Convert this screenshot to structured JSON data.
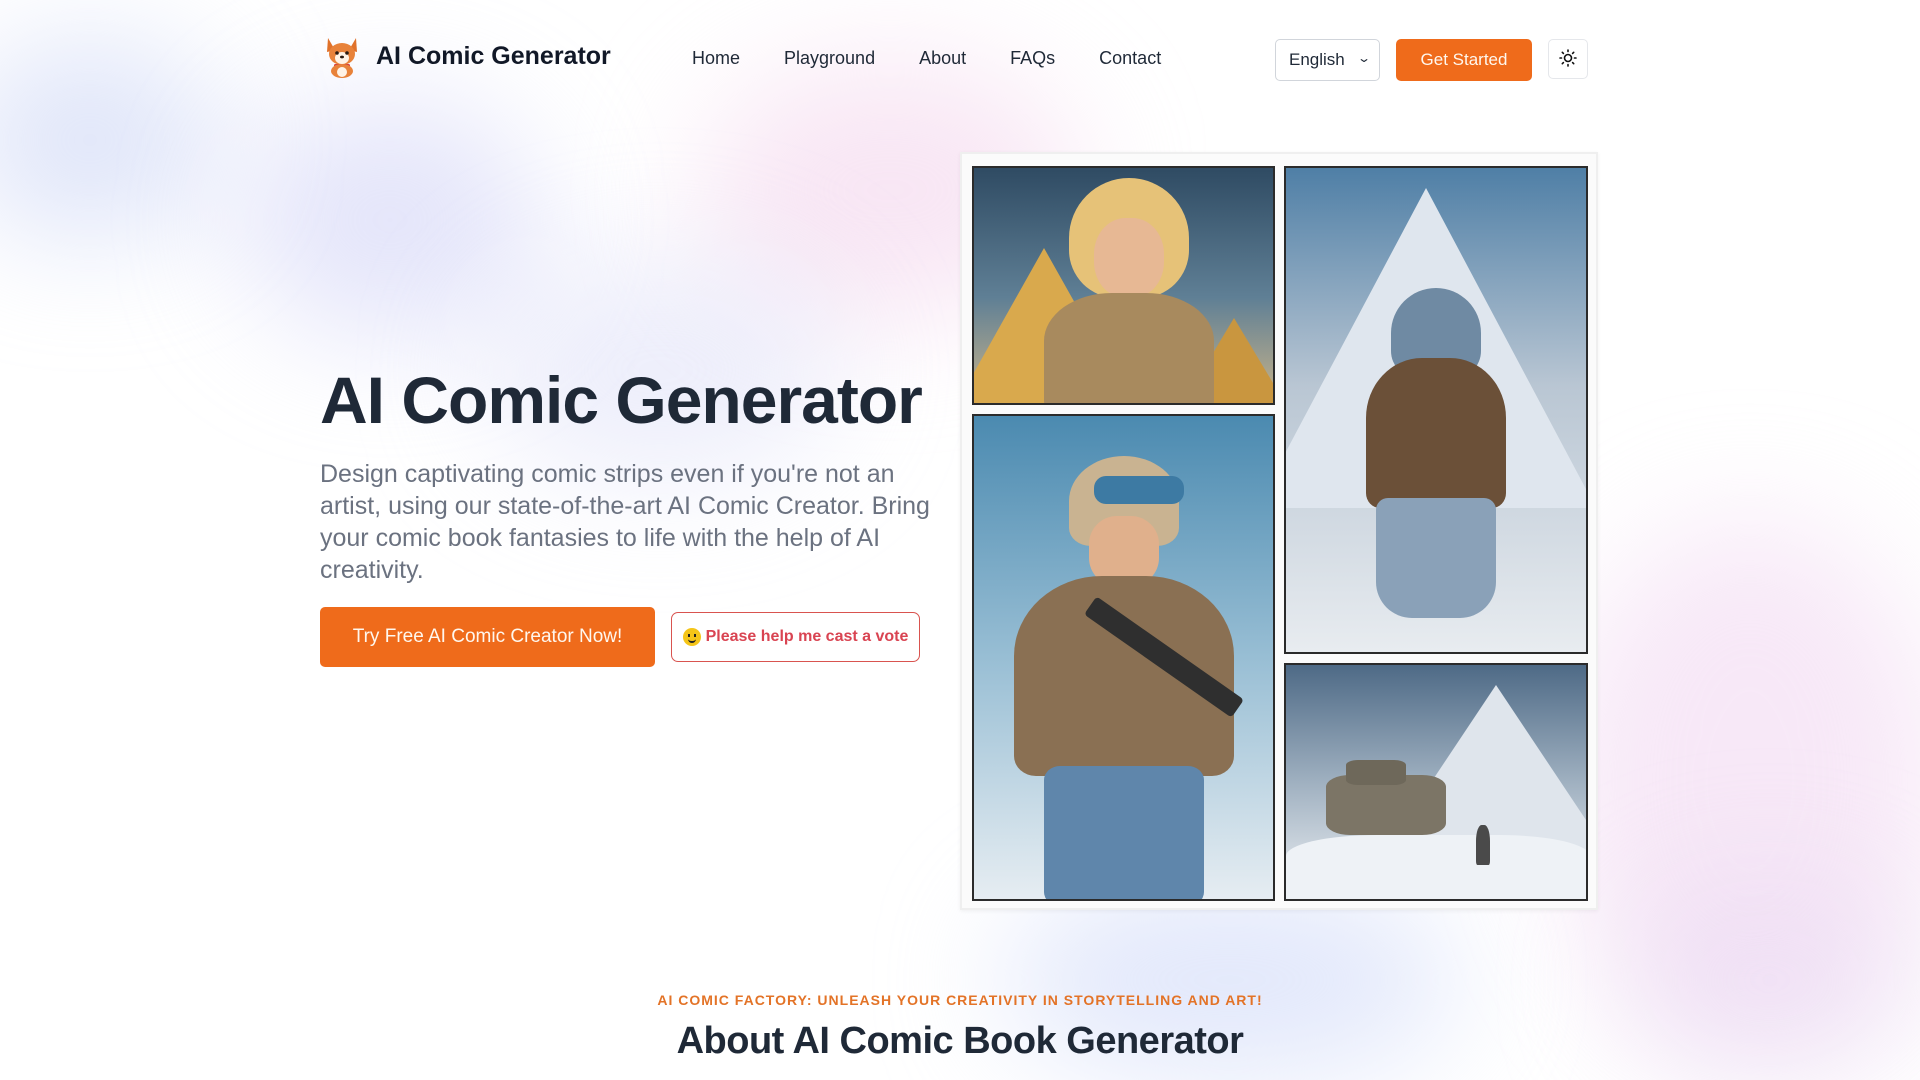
{
  "header": {
    "brand": "AI Comic Generator",
    "logo_icon": "corgi-mascot-icon",
    "nav": [
      {
        "label": "Home"
      },
      {
        "label": "Playground"
      },
      {
        "label": "About"
      },
      {
        "label": "FAQs"
      },
      {
        "label": "Contact"
      }
    ],
    "language": {
      "selected": "English",
      "icon": "chevron-down-icon"
    },
    "get_started_label": "Get Started",
    "theme_toggle_icon": "sun-icon"
  },
  "hero": {
    "title": "AI Comic Generator",
    "description": "Design captivating comic strips even if you're not an artist, using our state-of-the-art AI Comic Creator. Bring your comic book fantasies to life with the help of AI creativity.",
    "primary_cta": "Try Free AI Comic Creator Now!",
    "vote_button": {
      "emoji": "slightly-smiling-face-icon",
      "label": "Please help me cast a vote"
    },
    "comic_panels": [
      {
        "description": "Blonde woman in desert jacket before pyramids with falling snow"
      },
      {
        "description": "Muscular hooded warrior in snowstorm before white pyramids"
      },
      {
        "description": "Soldier in helmet and goggles holding rifle in snow"
      },
      {
        "description": "Tank driving through snow near pyramid"
      }
    ]
  },
  "about": {
    "kicker": "AI COMIC FACTORY: UNLEASH YOUR CREATIVITY IN STORYTELLING AND ART!",
    "title": "About AI Comic Book Generator"
  },
  "colors": {
    "accent": "#ef6b1b",
    "vote": "#d94452",
    "text_dark": "#1f2937",
    "text_muted": "#6b7280"
  }
}
